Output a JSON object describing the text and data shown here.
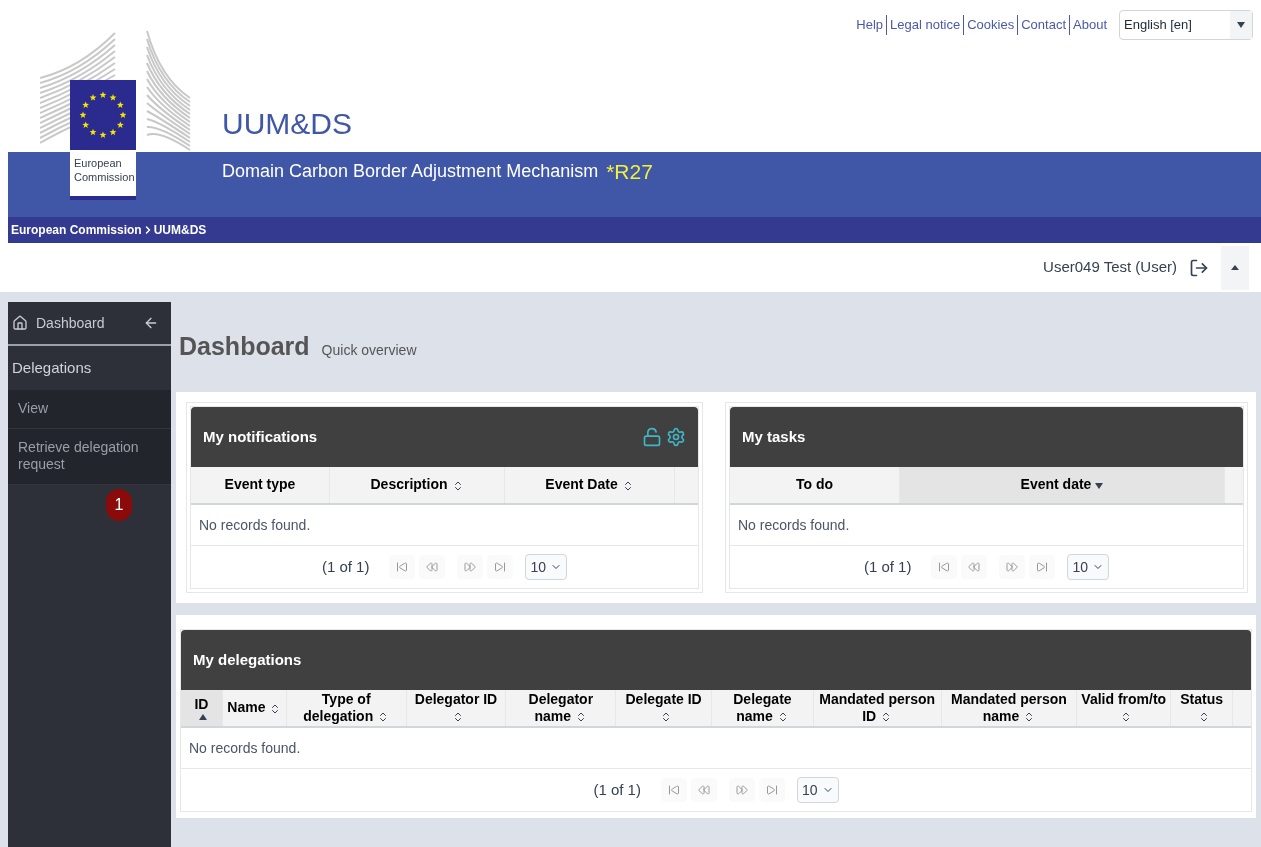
{
  "top_links": [
    "Help",
    "Legal notice",
    "Cookies",
    "Contact",
    "About"
  ],
  "language_select": {
    "value": "English [en]"
  },
  "logo": {
    "caption": "European Commission"
  },
  "app_title": "UUM&DS",
  "subtitle": "Domain Carbon Border Adjustment Mechanism",
  "release": "*R27",
  "breadcrumb": [
    "European Commission",
    "UUM&DS"
  ],
  "user": {
    "name": "User049 Test (User)"
  },
  "sidebar": {
    "header": "Dashboard",
    "section": "Delegations",
    "items": [
      {
        "label": "View",
        "selected": false
      },
      {
        "label": "Retrieve delegation request",
        "selected": false
      }
    ],
    "badge": "1"
  },
  "page": {
    "title": "Dashboard",
    "subtitle": "Quick overview"
  },
  "notifications": {
    "title": "My notifications",
    "columns": [
      {
        "label": "Event type",
        "sortable": false,
        "selected": false
      },
      {
        "label": "Description",
        "sortable": true,
        "selected": false
      },
      {
        "label": "Event Date",
        "sortable": true,
        "selected": false
      }
    ],
    "empty": "No records found.",
    "pager": {
      "text": "(1 of 1)",
      "page_size": "10",
      "disabled": true
    }
  },
  "tasks": {
    "title": "My tasks",
    "columns": [
      {
        "label": "To do",
        "sortable": false,
        "selected": false
      },
      {
        "label": "Event date",
        "sortable": true,
        "selected": true,
        "descending": true
      }
    ],
    "empty": "No records found.",
    "pager": {
      "text": "(1 of 1)",
      "page_size": "10",
      "disabled": true
    }
  },
  "delegations": {
    "title": "My delegations",
    "columns": [
      {
        "label": "ID",
        "sortable": true,
        "selected": true,
        "descending": false
      },
      {
        "label": "Name",
        "sortable": true,
        "selected": false
      },
      {
        "label": "Type of delegation",
        "sortable": true,
        "selected": false
      },
      {
        "label": "Delegator ID",
        "sortable": true,
        "selected": false
      },
      {
        "label": "Delegator name",
        "sortable": true,
        "selected": false
      },
      {
        "label": "Delegate ID",
        "sortable": true,
        "selected": false
      },
      {
        "label": "Delegate name",
        "sortable": true,
        "selected": false
      },
      {
        "label": "Mandated person ID",
        "sortable": true,
        "selected": false
      },
      {
        "label": "Mandated person name",
        "sortable": true,
        "selected": false
      },
      {
        "label": "Valid from/to",
        "sortable": true,
        "selected": false
      },
      {
        "label": "Status",
        "sortable": true,
        "selected": false
      }
    ],
    "empty": "No records found.",
    "pager": {
      "text": "(1 of 1)",
      "page_size": "10",
      "disabled": true
    }
  }
}
